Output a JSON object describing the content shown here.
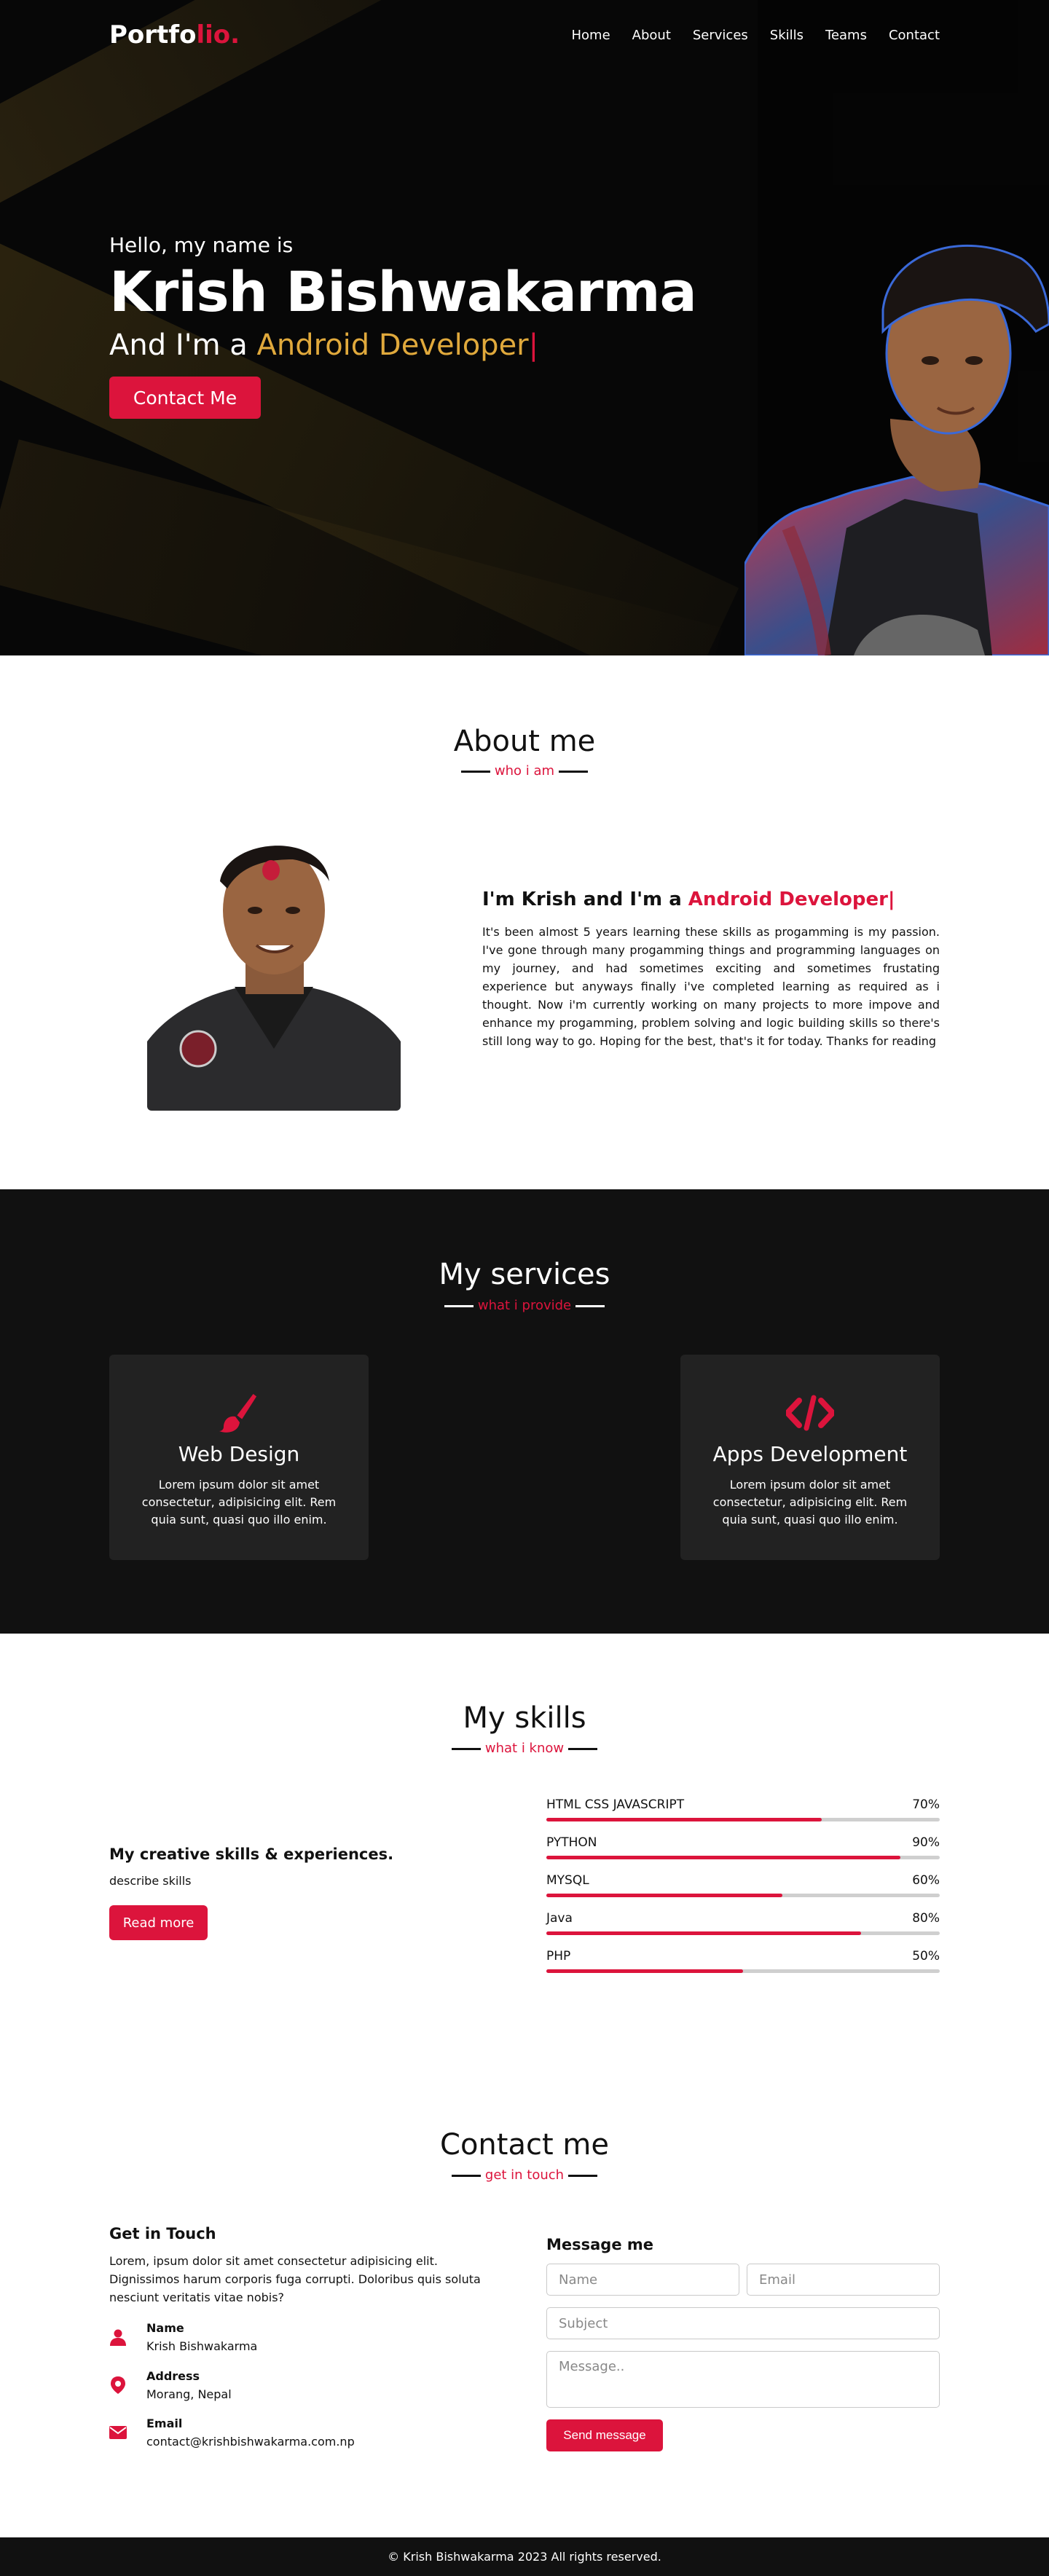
{
  "nav": {
    "logo_main": "Portfo",
    "logo_accent": "lio.",
    "items": [
      "Home",
      "About",
      "Services",
      "Skills",
      "Teams",
      "Contact"
    ]
  },
  "hero": {
    "hello": "Hello, my name is",
    "name": "Krish Bishwakarma",
    "role_prefix": "And I'm a ",
    "role_typed": "Android Developer",
    "cursor": "|",
    "button": "Contact Me"
  },
  "about": {
    "title": "About me",
    "subtitle": "who i am",
    "heading_prefix": "I'm Krish and I'm a ",
    "heading_typed": "Android Developer",
    "cursor": "|",
    "text": "It's been almost 5 years learning these skills as progamming is my passion. I've gone through many progamming things and programming languages on my journey, and had sometimes exciting and sometimes frustating experience but anyways finally i've completed learning as required as i thought. Now i'm currently working on many projects to more impove and enhance my progamming, problem solving and logic building skills so there's still long way to go. Hoping for the best, that's it for today. Thanks for reading"
  },
  "services": {
    "title": "My services",
    "subtitle": "what i provide",
    "cards": [
      {
        "icon": "paint-brush-icon",
        "title": "Web Design",
        "text": "Lorem ipsum dolor sit amet consectetur, adipisicing elit. Rem quia sunt, quasi quo illo enim."
      },
      {
        "icon": "code-icon",
        "title": "Apps Development",
        "text": "Lorem ipsum dolor sit amet consectetur, adipisicing elit. Rem quia sunt, quasi quo illo enim."
      }
    ]
  },
  "skills": {
    "title": "My skills",
    "subtitle": "what i know",
    "lead": "My creative skills & experiences.",
    "desc": "describe skills",
    "button": "Read more",
    "bars": [
      {
        "name": "HTML CSS JAVASCRIPT",
        "value_label": "70%",
        "percent": 70
      },
      {
        "name": "PYTHON",
        "value_label": "90%",
        "percent": 90
      },
      {
        "name": "MYSQL",
        "value_label": "60%",
        "percent": 60
      },
      {
        "name": "Java",
        "value_label": "80%",
        "percent": 80
      },
      {
        "name": "PHP",
        "value_label": "50%",
        "percent": 50
      }
    ]
  },
  "contact": {
    "title": "Contact me",
    "subtitle": "get in touch",
    "get_in_touch": "Get in Touch",
    "text": "Lorem, ipsum dolor sit amet consectetur adipisicing elit. Dignissimos harum corporis fuga corrupti. Doloribus quis soluta nesciunt veritatis vitae nobis?",
    "name_label": "Name",
    "name_value": "Krish Bishwakarma",
    "address_label": "Address",
    "address_value": "Morang, Nepal",
    "email_label": "Email",
    "email_value": "contact@krishbishwakarma.com.np",
    "message_title": "Message me",
    "placeholders": {
      "name": "Name",
      "email": "Email",
      "subject": "Subject",
      "message": "Message.."
    },
    "send": "Send message"
  },
  "footer": {
    "text": "© Krish Bishwakarma 2023 All rights reserved."
  },
  "colors": {
    "accent": "#dc143c",
    "hero_typed": "#e0a93c",
    "dark_bg": "#111111",
    "card_bg": "#222222"
  }
}
